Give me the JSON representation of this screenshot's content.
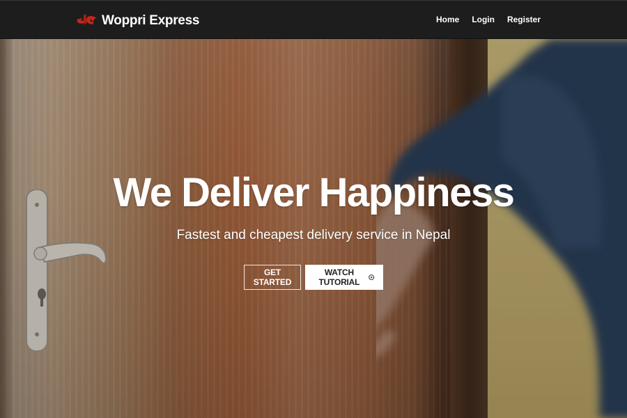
{
  "navbar": {
    "brand_name": "Woppri Express",
    "links": [
      {
        "label": "Home"
      },
      {
        "label": "Login"
      },
      {
        "label": "Register"
      }
    ],
    "background_color": "#1d1d1d"
  },
  "hero": {
    "title": "We Deliver Happiness",
    "subtitle": "Fastest and cheapest delivery service in Nepal",
    "primary_button": {
      "label": "GET STARTED",
      "style": "outline"
    },
    "secondary_button": {
      "label": "WATCH TUTORIAL",
      "icon": "play-circle-icon",
      "style": "solid-white"
    }
  },
  "colors": {
    "logo_red": "#c0281c",
    "text_white": "#ffffff",
    "button_text_dark": "#222222"
  }
}
